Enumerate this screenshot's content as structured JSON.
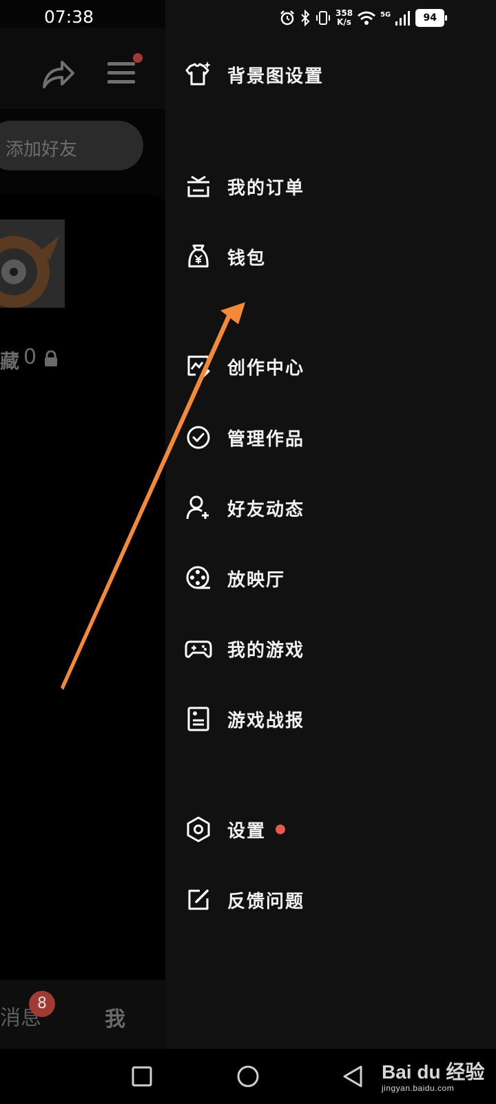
{
  "status_bar": {
    "time": "07:38",
    "net_speed_value": "358",
    "net_speed_unit": "K/s",
    "network": "5G",
    "battery": "94"
  },
  "background_app": {
    "search_placeholder": "添加好友",
    "favorites_label": "藏",
    "favorites_count": "0",
    "tabs": {
      "messages": "消息",
      "messages_badge": "8",
      "me": "我"
    }
  },
  "drawer": {
    "items": [
      {
        "label": "背景图设置",
        "icon": "shirt-sparkle-icon"
      },
      {
        "label": "我的订单",
        "icon": "order-icon"
      },
      {
        "label": "钱包",
        "icon": "wallet-bag-icon"
      },
      {
        "label": "创作中心",
        "icon": "creator-icon"
      },
      {
        "label": "管理作品",
        "icon": "check-circle-icon"
      },
      {
        "label": "好友动态",
        "icon": "friend-icon"
      },
      {
        "label": "放映厅",
        "icon": "film-reel-icon"
      },
      {
        "label": "我的游戏",
        "icon": "gamepad-icon"
      },
      {
        "label": "游戏战报",
        "icon": "report-icon"
      },
      {
        "label": "设置",
        "icon": "settings-hex-icon",
        "has_dot": true
      },
      {
        "label": "反馈问题",
        "icon": "feedback-edit-icon"
      }
    ]
  },
  "watermark": {
    "brand": "Bai du 经验",
    "url": "jingyan.baidu.com"
  },
  "colors": {
    "drawer_bg": "#111111",
    "arrow": "#f28a3a",
    "dot": "#e5594f"
  }
}
